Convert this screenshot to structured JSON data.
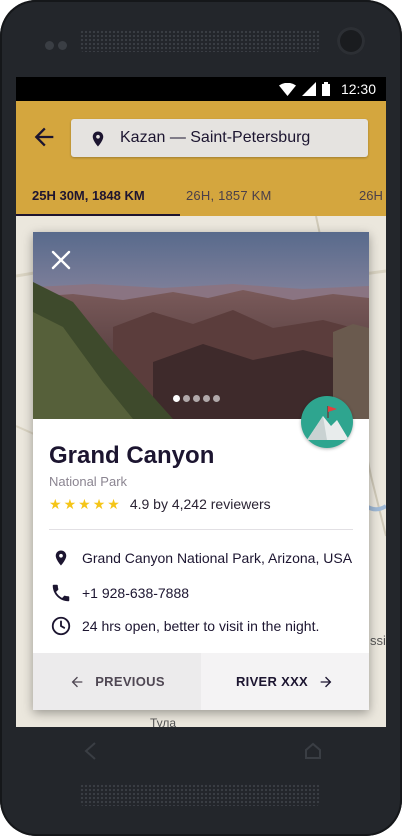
{
  "status_bar": {
    "time": "12:30"
  },
  "toolbar": {
    "search_text": "Kazan — Saint-Petersburg",
    "tabs": [
      {
        "label": "25H 30M, 1848 KM",
        "selected": true
      },
      {
        "label": "26H, 1857 KM",
        "selected": false
      },
      {
        "label": "26H",
        "selected": false
      }
    ]
  },
  "map": {
    "labels": [
      "ssi",
      "Тула"
    ]
  },
  "card": {
    "title": "Grand Canyon",
    "subtitle": "National Park",
    "rating": {
      "stars": 5,
      "text": "4.9 by 4,242 reviewers"
    },
    "photo_dots": 5,
    "photo_dot_active": 0,
    "info": {
      "address": "Grand Canyon National Park, Arizona, USA",
      "phone": "+1 928-638-7888",
      "hours": "24 hrs open, better to visit in the night."
    },
    "footer": {
      "prev_label": "PREVIOUS",
      "next_label": "RIVER XXX"
    }
  },
  "colors": {
    "toolbar": "#d4a63e",
    "text_dark": "#1c1530",
    "star": "#f5c518",
    "avatar_bg": "#2ea58f"
  },
  "icons": [
    "wifi-icon",
    "signal-icon",
    "battery-icon",
    "back-arrow-icon",
    "location-pin-icon",
    "close-icon",
    "star-icon",
    "phone-icon",
    "clock-icon",
    "arrow-left-icon",
    "arrow-right-icon"
  ]
}
